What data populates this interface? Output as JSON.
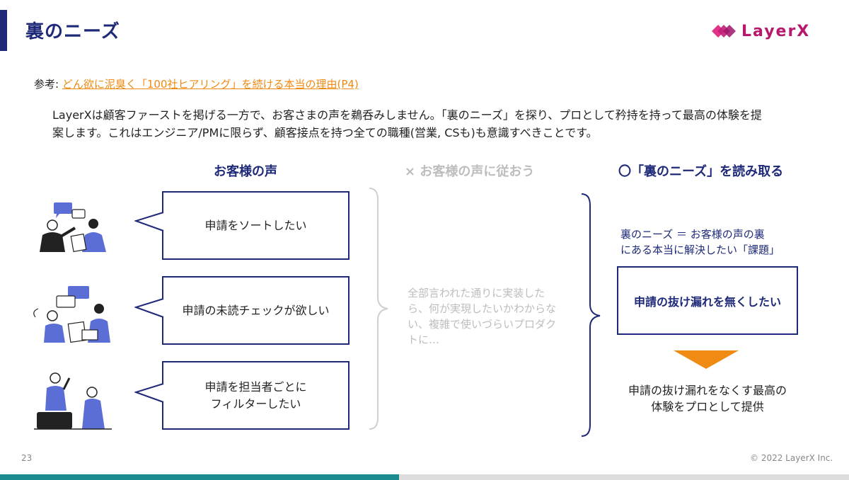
{
  "slide": {
    "title": "裏のニーズ",
    "logo_text": "LayerX",
    "reference": {
      "label": "参考:",
      "link_text": "どん欲に泥臭く「100社ヒアリング」を続ける本当の理由(P4)"
    },
    "intro": "LayerXは顧客ファーストを掲げる一方で、お客さまの声を鵜呑みしません。「裏のニーズ」を探り、プロとして矜持を持って最高の体験を提案します。これはエンジニア/PMに限らず、顧客接点を持つ全ての職種(営業, CSも)も意識すべきことです。",
    "columns": {
      "voice": "お客様の声",
      "follow": "× お客様の声に従おう",
      "read": "〇「裏のニーズ」を読み取る"
    },
    "voices": [
      {
        "lines": [
          "申請をソートしたい"
        ]
      },
      {
        "lines": [
          "申請の未読チェックが欲しい"
        ]
      },
      {
        "lines": [
          "申請を担当者ごとに",
          "フィルターしたい"
        ]
      }
    ],
    "follow_result": "全部言われた通りに実装したら、何が実現したいかわからない、複雑で使いづらいプロダクトに…",
    "definition_line1": "裏のニーズ ＝ お客様の声の裏",
    "definition_line2": "にある本当に解決したい「課題」",
    "real_need": "申請の抜け漏れを無くしたい",
    "result_line1": "申請の抜け漏れをなくす最高の",
    "result_line2": "体験をプロとして提供",
    "page_number": "23",
    "copyright": "© 2022 LayerX Inc."
  },
  "progress": 0.47,
  "colors": {
    "navy": "#1e2a78",
    "orange": "#ef8a12",
    "logo_pink": "#b8186c",
    "person_blue": "#5b6ed6",
    "gray": "#bdbdbd",
    "progress_teal": "#1b8a8f"
  }
}
